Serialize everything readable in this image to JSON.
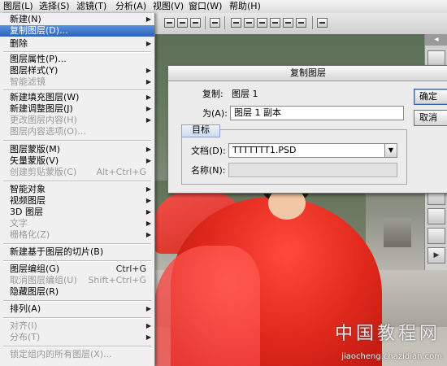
{
  "menubar": {
    "items": [
      "图层(L)",
      "选择(S)",
      "滤镜(T)",
      "分析(A)",
      "视图(V)",
      "窗口(W)",
      "帮助(H)"
    ]
  },
  "layer_menu": {
    "items": [
      {
        "label": "新建(N)",
        "arrow": true,
        "disabled": false
      },
      {
        "label": "复制图层(D)...",
        "highlighted": true,
        "disabled": false
      },
      {
        "label": "删除",
        "arrow": true,
        "disabled": false
      },
      {
        "label": "图层属性(P)...",
        "disabled": false
      },
      {
        "label": "图层样式(Y)",
        "arrow": true,
        "disabled": false
      },
      {
        "label": "智能滤镜",
        "arrow": true,
        "disabled": true
      },
      {
        "label": "新建填充图层(W)",
        "arrow": true,
        "disabled": false
      },
      {
        "label": "新建调整图层(J)",
        "arrow": true,
        "disabled": false
      },
      {
        "label": "更改图层内容(H)",
        "arrow": true,
        "disabled": true
      },
      {
        "label": "图层内容选项(O)...",
        "disabled": true
      },
      {
        "label": "图层蒙版(M)",
        "arrow": true,
        "disabled": false
      },
      {
        "label": "矢量蒙版(V)",
        "arrow": true,
        "disabled": false
      },
      {
        "label": "创建剪贴蒙版(C)",
        "shortcut": "Alt+Ctrl+G",
        "disabled": true
      },
      {
        "label": "智能对象",
        "arrow": true,
        "disabled": false
      },
      {
        "label": "视频图层",
        "arrow": true,
        "disabled": false
      },
      {
        "label": "3D 图层",
        "arrow": true,
        "disabled": false
      },
      {
        "label": "文字",
        "arrow": true,
        "disabled": true
      },
      {
        "label": "栅格化(Z)",
        "arrow": true,
        "disabled": true
      },
      {
        "label": "新建基于图层的切片(B)",
        "disabled": false
      },
      {
        "label": "图层编组(G)",
        "shortcut": "Ctrl+G",
        "disabled": false
      },
      {
        "label": "取消图层编组(U)",
        "shortcut": "Shift+Ctrl+G",
        "disabled": true
      },
      {
        "label": "隐藏图层(R)",
        "disabled": false
      },
      {
        "label": "排列(A)",
        "arrow": true,
        "disabled": false
      },
      {
        "label": "对齐(I)",
        "arrow": true,
        "disabled": true
      },
      {
        "label": "分布(T)",
        "arrow": true,
        "disabled": true
      },
      {
        "label": "锁定组内的所有图层(X)...",
        "disabled": true
      }
    ]
  },
  "dialog": {
    "title": "复制图层",
    "copy_label": "复制:",
    "copy_value": "图层 1",
    "as_label": "为(A):",
    "as_value": "图层 1 副本",
    "group_title": "目标",
    "document_label": "文档(D):",
    "document_value": "TTTTTTT1.PSD",
    "name_label": "名称(N):",
    "name_value": "",
    "ok_label": "确定",
    "cancel_label": "取消"
  },
  "watermark": {
    "text": "中国教程网",
    "url": "jiaocheng.chazidian.com"
  },
  "arrow_glyph": "▶",
  "select_arrow_glyph": "▼"
}
